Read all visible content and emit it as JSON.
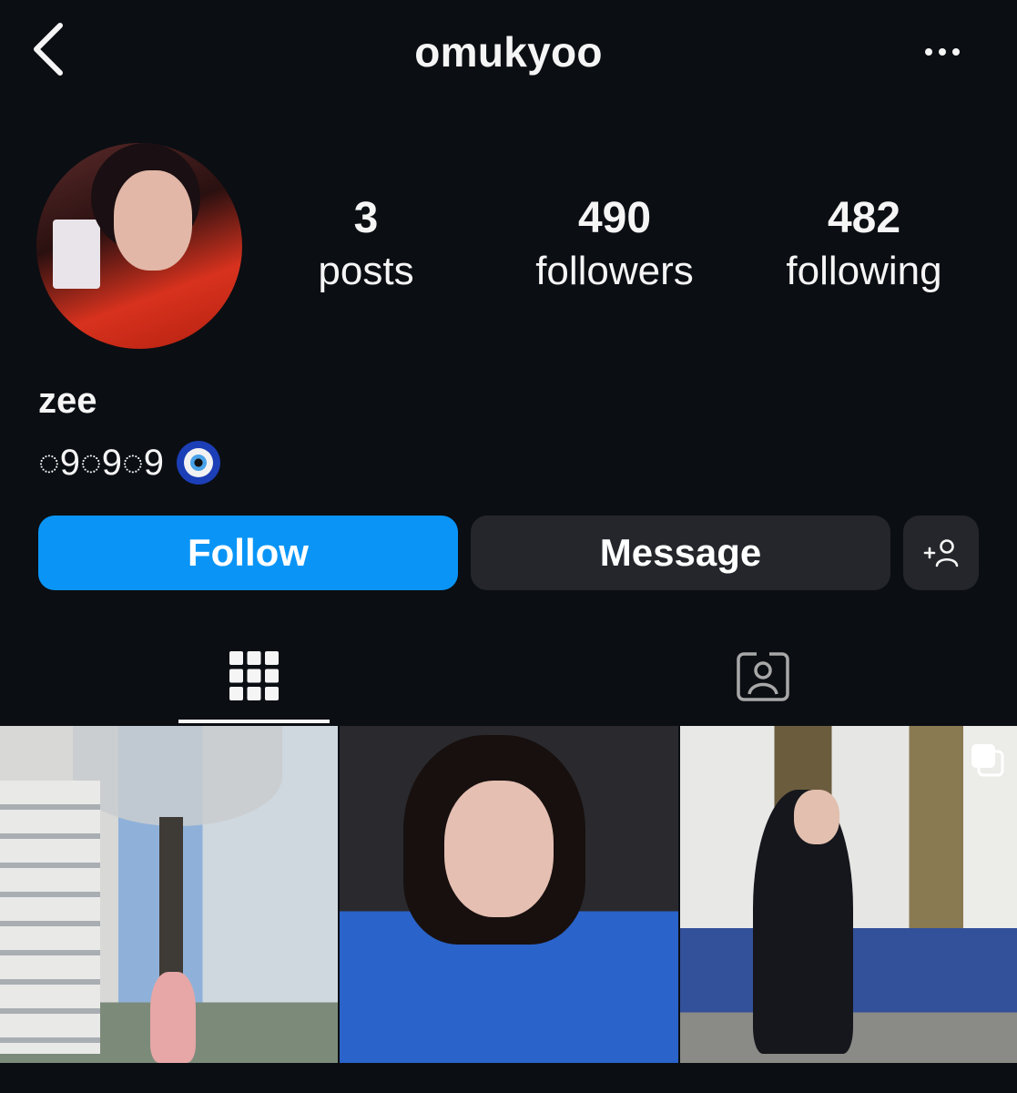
{
  "header": {
    "username": "omukyoo",
    "back_icon": "chevron-left-icon",
    "more_icon": "more-horizontal-icon"
  },
  "stats": [
    {
      "value": "3",
      "label": "posts"
    },
    {
      "value": "490",
      "label": "followers"
    },
    {
      "value": "482",
      "label": "following"
    }
  ],
  "profile": {
    "name": "zee",
    "bio": "◌9◌9◌9",
    "bio_emoji": "evil-eye-icon"
  },
  "actions": {
    "follow_label": "Follow",
    "message_label": "Message",
    "add_user_icon": "add-user-icon"
  },
  "tabs": [
    {
      "icon": "grid-icon",
      "active": true
    },
    {
      "icon": "tagged-icon",
      "active": false
    }
  ],
  "colors": {
    "background": "#0b0e13",
    "follow": "#0a95f6",
    "secondary_button": "#24262b"
  }
}
